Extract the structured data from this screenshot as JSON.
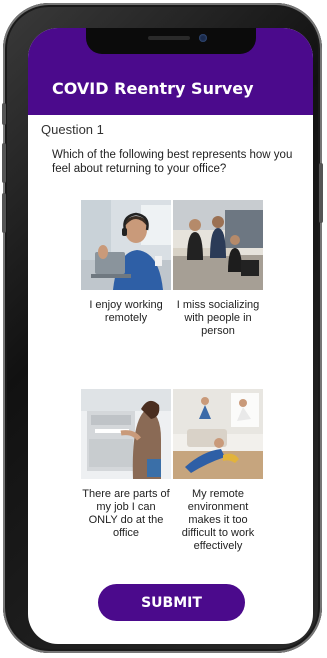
{
  "header": {
    "title": "COVID Reentry Survey"
  },
  "question": {
    "number_label": "Question 1",
    "text": "Which of the following best represents how you feel about returning to your office?"
  },
  "options": [
    {
      "label": "I enjoy working remotely",
      "image": "person-video-call-photo"
    },
    {
      "label": "I miss socializing with people in person",
      "image": "office-coworkers-photo"
    },
    {
      "label": "There are parts of my job I can ONLY do at the office",
      "image": "office-printer-photo"
    },
    {
      "label": "My remote environment makes it too difficult to work effectively",
      "image": "kids-playing-home-photo"
    }
  ],
  "submit": {
    "label": "SUBMIT"
  },
  "colors": {
    "brand": "#4b0a8c",
    "background": "#ffffff"
  }
}
